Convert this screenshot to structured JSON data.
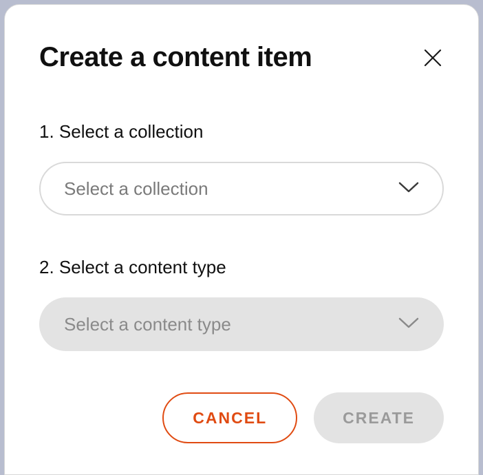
{
  "modal": {
    "title": "Create a content item",
    "step1": {
      "label": "1. Select a collection",
      "placeholder": "Select a collection"
    },
    "step2": {
      "label": "2. Select a content type",
      "placeholder": "Select a content type"
    },
    "actions": {
      "cancel": "CANCEL",
      "create": "CREATE"
    }
  }
}
